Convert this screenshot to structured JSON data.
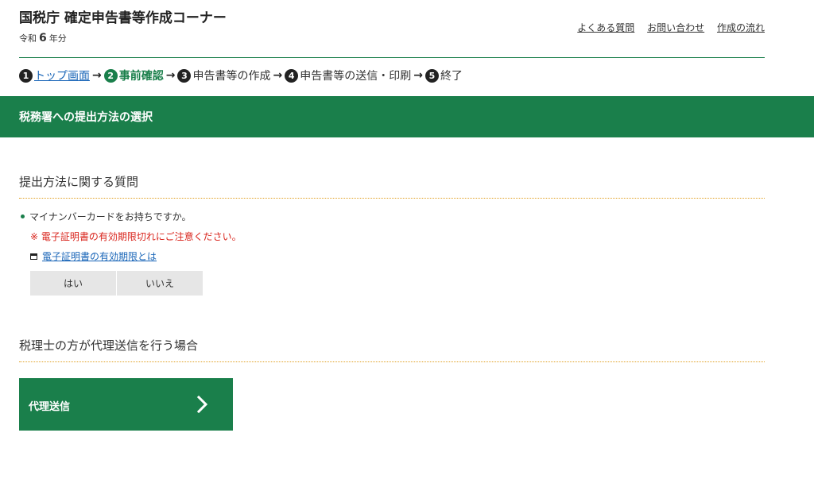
{
  "header": {
    "site_title": "国税庁 確定申告書等作成コーナー",
    "era_prefix": "令和",
    "era_year": "6",
    "era_suffix": "年分",
    "links": [
      "よくある質問",
      "お問い合わせ",
      "作成の流れ"
    ]
  },
  "steps": [
    {
      "num": "1",
      "label": "トップ画面",
      "state": "link"
    },
    {
      "num": "2",
      "label": "事前確認",
      "state": "current"
    },
    {
      "num": "3",
      "label": "申告書等の作成",
      "state": "normal"
    },
    {
      "num": "4",
      "label": "申告書等の送信・印刷",
      "state": "normal"
    },
    {
      "num": "5",
      "label": "終了",
      "state": "normal"
    }
  ],
  "step_arrow": "→",
  "banner": {
    "title": "税務署への提出方法の選択"
  },
  "section1": {
    "heading": "提出方法に関する質問",
    "question": "マイナンバーカードをお持ちですか。",
    "warning": "※ 電子証明書の有効期限切れにご注意ください。",
    "info_link": "電子証明書の有効期限とは",
    "yes_label": "はい",
    "no_label": "いいえ"
  },
  "section2": {
    "heading": "税理士の方が代理送信を行う場合",
    "button_label": "代理送信"
  },
  "colors": {
    "brand_green": "#1a7f4b",
    "link_blue": "#1a66b8",
    "warning_red": "#d9251d",
    "dotted_rule": "#e0a020"
  },
  "icons": {
    "step_circles": "numbered-circle-icon",
    "info_link": "window-icon",
    "proxy_button": "chevron-right-icon"
  }
}
